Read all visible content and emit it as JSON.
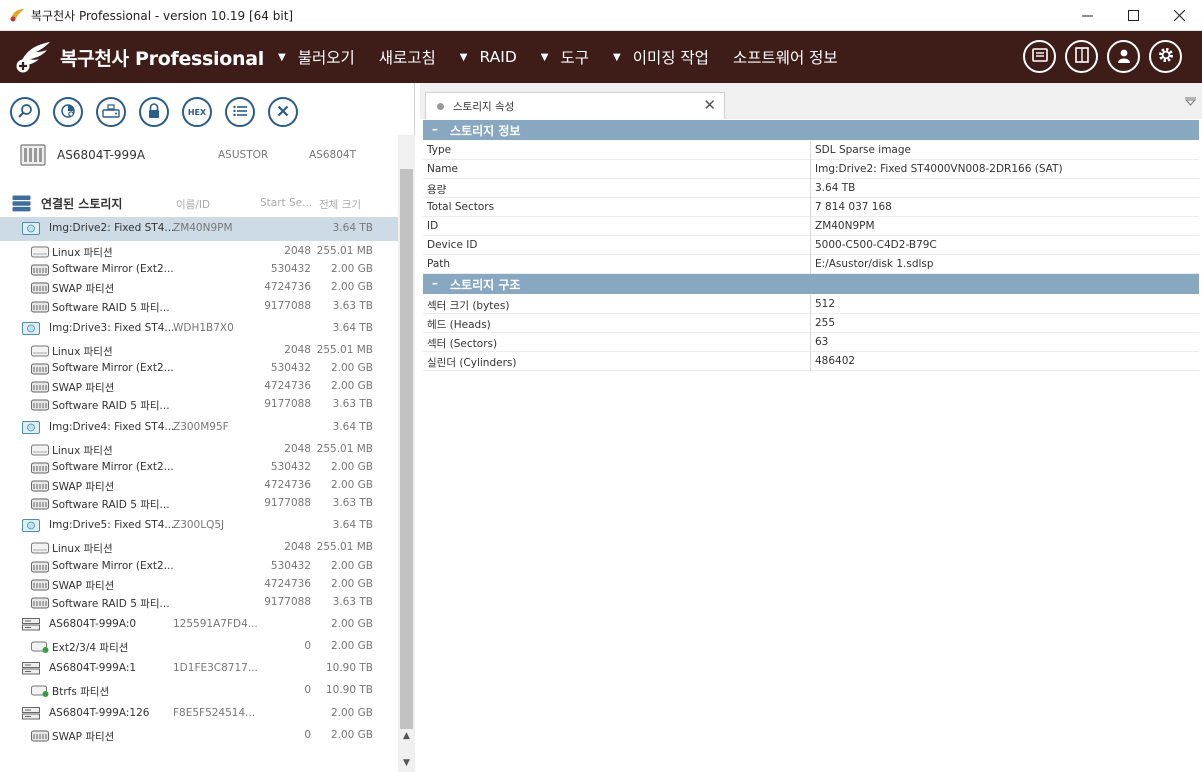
{
  "window": {
    "title": "복구천사 Professional - version 10.19 [64 bit]",
    "minimize": "—",
    "maximize": "☐",
    "close": "✕"
  },
  "brand": {
    "name": "복구천사 Professional"
  },
  "menu": [
    {
      "label": "불러오기",
      "has_arrow": true
    },
    {
      "label": "새로고침",
      "has_arrow": false
    },
    {
      "label": "RAID",
      "has_arrow": true
    },
    {
      "label": "도구",
      "has_arrow": true
    },
    {
      "label": "이미징 작업",
      "has_arrow": true
    },
    {
      "label": "소프트웨어 정보",
      "has_arrow": false
    }
  ],
  "menu_arrow": "▼",
  "toolbar_icons": [
    "search-icon",
    "scan-icon",
    "image-disk-icon",
    "lock-icon",
    "hex-icon",
    "list-icon",
    "close-icon"
  ],
  "toolbar_hex": "HEX",
  "device": {
    "name": "AS6804T-999A",
    "vendor": "ASUSTOR",
    "model": "AS6804T"
  },
  "storage_header": {
    "title": "연결된 스토리지",
    "col_name": "이름/ID",
    "col_start": "Start Se...",
    "col_size": "전체 크기"
  },
  "tree": [
    {
      "kind": "disk",
      "name": "Img:Drive2: Fixed ST4...",
      "id": "ZM40N9PM",
      "start": "",
      "size": "3.64 TB",
      "selected": true
    },
    {
      "kind": "part",
      "name": "Linux 파티션",
      "id": "",
      "start": "2048",
      "size": "255.01 MB"
    },
    {
      "kind": "part2",
      "name": "Software Mirror (Ext2...",
      "id": "",
      "start": "530432",
      "size": "2.00 GB"
    },
    {
      "kind": "part2",
      "name": "SWAP 파티션",
      "id": "",
      "start": "4724736",
      "size": "2.00 GB"
    },
    {
      "kind": "part2",
      "name": "Software RAID 5 파티...",
      "id": "",
      "start": "9177088",
      "size": "3.63 TB"
    },
    {
      "kind": "disk",
      "name": "Img:Drive3: Fixed ST4...",
      "id": "WDH1B7X0",
      "start": "",
      "size": "3.64 TB"
    },
    {
      "kind": "part",
      "name": "Linux 파티션",
      "id": "",
      "start": "2048",
      "size": "255.01 MB"
    },
    {
      "kind": "part2",
      "name": "Software Mirror (Ext2...",
      "id": "",
      "start": "530432",
      "size": "2.00 GB"
    },
    {
      "kind": "part2",
      "name": "SWAP 파티션",
      "id": "",
      "start": "4724736",
      "size": "2.00 GB"
    },
    {
      "kind": "part2",
      "name": "Software RAID 5 파티...",
      "id": "",
      "start": "9177088",
      "size": "3.63 TB"
    },
    {
      "kind": "disk",
      "name": "Img:Drive4: Fixed ST4...",
      "id": "Z300M95F",
      "start": "",
      "size": "3.64 TB"
    },
    {
      "kind": "part",
      "name": "Linux 파티션",
      "id": "",
      "start": "2048",
      "size": "255.01 MB"
    },
    {
      "kind": "part2",
      "name": "Software Mirror (Ext2...",
      "id": "",
      "start": "530432",
      "size": "2.00 GB"
    },
    {
      "kind": "part2",
      "name": "SWAP 파티션",
      "id": "",
      "start": "4724736",
      "size": "2.00 GB"
    },
    {
      "kind": "part2",
      "name": "Software RAID 5 파티...",
      "id": "",
      "start": "9177088",
      "size": "3.63 TB"
    },
    {
      "kind": "disk",
      "name": "Img:Drive5: Fixed ST4...",
      "id": "Z300LQ5J",
      "start": "",
      "size": "3.64 TB"
    },
    {
      "kind": "part",
      "name": "Linux 파티션",
      "id": "",
      "start": "2048",
      "size": "255.01 MB"
    },
    {
      "kind": "part2",
      "name": "Software Mirror (Ext2...",
      "id": "",
      "start": "530432",
      "size": "2.00 GB"
    },
    {
      "kind": "part2",
      "name": "SWAP 파티션",
      "id": "",
      "start": "4724736",
      "size": "2.00 GB"
    },
    {
      "kind": "part2",
      "name": "Software RAID 5 파티...",
      "id": "",
      "start": "9177088",
      "size": "3.63 TB"
    },
    {
      "kind": "raid",
      "name": "AS6804T-999A:0",
      "id": "125591A7FD4...",
      "start": "",
      "size": "2.00 GB"
    },
    {
      "kind": "partg",
      "name": "Ext2/3/4 파티션",
      "id": "",
      "start": "0",
      "size": "2.00 GB"
    },
    {
      "kind": "raid",
      "name": "AS6804T-999A:1",
      "id": "1D1FE3C8717...",
      "start": "",
      "size": "10.90 TB"
    },
    {
      "kind": "partg",
      "name": "Btrfs 파티션",
      "id": "",
      "start": "0",
      "size": "10.90 TB"
    },
    {
      "kind": "raid",
      "name": "AS6804T-999A:126",
      "id": "F8E5F524514...",
      "start": "",
      "size": "2.00 GB"
    },
    {
      "kind": "part2",
      "name": "SWAP 파티션",
      "id": "",
      "start": "0",
      "size": "2.00 GB"
    }
  ],
  "tab": {
    "label": "스토리지 속성",
    "close": "✕"
  },
  "sections": [
    {
      "title": "스토리지 정보",
      "rows": [
        {
          "key": "Type",
          "value": "SDL Sparse image"
        },
        {
          "key": "Name",
          "value": "Img:Drive2: Fixed ST4000VN008-2DR166 (SAT)"
        },
        {
          "key": "용량",
          "value": "3.64 TB"
        },
        {
          "key": "Total Sectors",
          "value": "7 814 037 168"
        },
        {
          "key": "ID",
          "value": "ZM40N9PM"
        },
        {
          "key": "Device ID",
          "value": "5000-C500-C4D2-B79C"
        },
        {
          "key": "Path",
          "value": "E:/Asustor/disk 1.sdlsp"
        }
      ]
    },
    {
      "title": "스토리지 구조",
      "rows": [
        {
          "key": "섹터 크기 (bytes)",
          "value": "512"
        },
        {
          "key": "헤드 (Heads)",
          "value": "255"
        },
        {
          "key": "섹터 (Sectors)",
          "value": "63"
        },
        {
          "key": "실린더 (Cylinders)",
          "value": "486402"
        }
      ]
    }
  ],
  "section_toggle": "–",
  "colors": {
    "brand_bar": "#3e1c17",
    "section_header": "#88a7c0",
    "selection": "#cddbe6",
    "toolbar_icon": "#2b5c8a"
  }
}
